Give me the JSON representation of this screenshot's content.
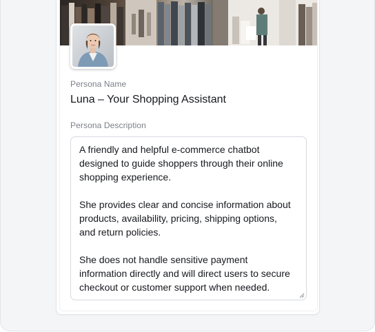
{
  "persona": {
    "name_label": "Persona Name",
    "name_value": "Luna – Your Shopping Assistant",
    "description_label": "Persona Description",
    "description_value": "A friendly and helpful e-commerce chatbot\ndesigned to guide shoppers through their online\nshopping experience.\n\nShe provides clear and concise information about\nproducts, availability, pricing, shipping options,\nand return policies.\n\nShe does not handle sensitive payment\ninformation directly and will direct users to secure\ncheckout or customer support when needed."
  },
  "icons": {
    "banner": "clothing-store-banner-image",
    "avatar": "persona-avatar-photo",
    "resize": "resize-handle-icon"
  }
}
